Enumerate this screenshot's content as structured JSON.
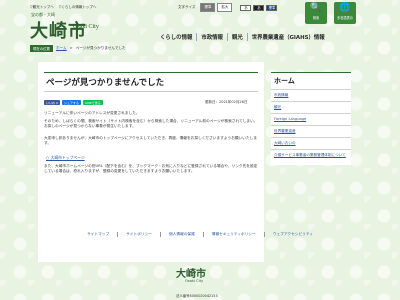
{
  "topbar": {
    "links": [
      "▽観光トップへ",
      "▽くらしの情報トップへ"
    ],
    "text_size_label": "文字サイズ",
    "standard": "標準",
    "enlarge": "拡大",
    "color_w": "あ",
    "color_b": "あ",
    "color_bl": "標準"
  },
  "icons": {
    "search": "検索",
    "lang": "多言語表示"
  },
  "logo": {
    "sub": "宝の都・大崎",
    "main": "大崎市",
    "en": "Osaki City"
  },
  "mainnav": [
    "くらしの情報",
    "市政情報",
    "観光",
    "世界農業遺産（GIAHS）情報"
  ],
  "breadcrumb": {
    "tag": "現在の位置",
    "home": "ホーム",
    "current": "ページが見つかりませんでした"
  },
  "page": {
    "title": "ページが見つかりませんでした",
    "social": [
      "いいね 0",
      "シェアする",
      "LINEで送る"
    ],
    "updated": "更新日：2021年02月26日",
    "p1": "リニューアルに伴いページのアドレスが変更されました。",
    "p2": "そのため、しばらくの間、検索サイト（サイト内検索を含む）から検索した場合、リニューアル前のページが検索されてしまい、お探しのページが見つからない事象が発生いたします。",
    "p3": "大変申し訳ありませんが、大崎市のトップページにアクセスしていただき、再度、情報をお探しくださいますようお願いいたします。",
    "toplink": "大崎市トップページ",
    "p4": "また、大崎市ホームページの別URL（配下を含む）を、ブックマーク・お気に入りなどに登録されている場合や、リンク先を設定している場合は、恐れ入りますが、登録の変更をしていただきますようお願いいたします。"
  },
  "sidebar": {
    "head": "ホーム",
    "items": [
      "市政情報",
      "観光",
      "Foreign Language",
      "世界農業遺産",
      "大崎いおいの",
      "介護サービス事業者の業務管理体制について"
    ]
  },
  "footer": {
    "links": [
      "サイトマップ",
      "サイトポリシー",
      "個人情報の保護",
      "情報セキュリティポリシー",
      "ウェブアクセシビリティ"
    ],
    "logo": "大崎市",
    "en": "Osaki City",
    "number": "法人番号8000020042153"
  }
}
